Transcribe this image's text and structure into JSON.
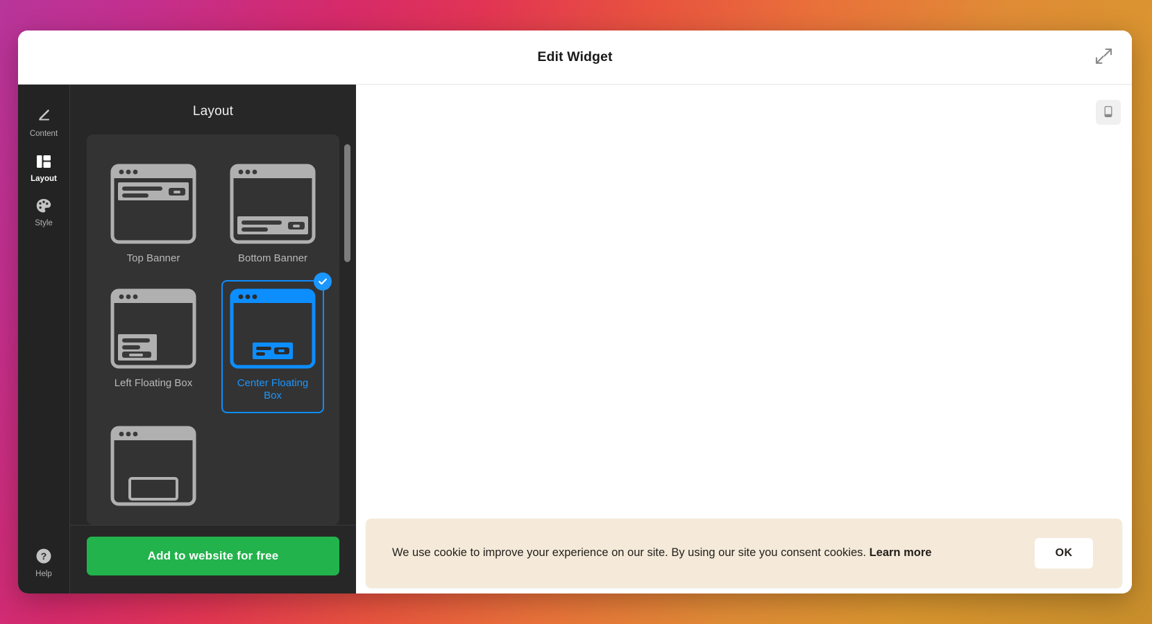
{
  "modal": {
    "title": "Edit Widget",
    "expand_icon": "expand-diagonal-icon"
  },
  "rail": {
    "items": [
      {
        "label": "Content",
        "icon": "pencil-icon",
        "active": false
      },
      {
        "label": "Layout",
        "icon": "layout-columns-icon",
        "active": true
      },
      {
        "label": "Style",
        "icon": "palette-icon",
        "active": false
      }
    ],
    "help": {
      "label": "Help",
      "icon": "question-circle-icon"
    }
  },
  "panel": {
    "title": "Layout",
    "cards": [
      {
        "label": "Top Banner",
        "variant": "top",
        "selected": false
      },
      {
        "label": "Bottom Banner",
        "variant": "bottom",
        "selected": false
      },
      {
        "label": "Left Floating Box",
        "variant": "left",
        "selected": false
      },
      {
        "label": "Center Floating Box",
        "variant": "center",
        "selected": true
      },
      {
        "label": "",
        "variant": "partial",
        "selected": false
      }
    ],
    "cta_label": "Add to website for free"
  },
  "preview": {
    "device_toggle_icon": "mobile-phone-icon",
    "cookie_banner": {
      "text": "We use cookie to improve your experience on our site. By using our site you consent cookies. ",
      "link_label": "Learn more",
      "ok_label": "OK"
    }
  },
  "colors": {
    "accent_blue": "#1b96ff",
    "cta_green": "#22b34c",
    "panel_bg": "#272727",
    "rail_bg": "#232323",
    "cookie_bg": "#f5ead9"
  }
}
